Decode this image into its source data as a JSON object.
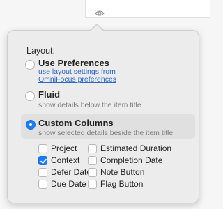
{
  "toolbar": {
    "view_options_icon": "eye-icon"
  },
  "popover": {
    "heading": "Layout:",
    "options": [
      {
        "title": "Use Preferences",
        "link": "use layout settings from OmniFocus preferences",
        "selected": false
      },
      {
        "title": "Fluid",
        "description": "show details below the item title",
        "selected": false
      },
      {
        "title": "Custom Columns",
        "description": "show selected details beside the item title",
        "selected": true
      }
    ],
    "columns": [
      {
        "label": "Project",
        "checked": false
      },
      {
        "label": "Estimated Duration",
        "checked": false
      },
      {
        "label": "Context",
        "checked": true
      },
      {
        "label": "Completion Date",
        "checked": false
      },
      {
        "label": "Defer Date",
        "checked": false
      },
      {
        "label": "Note Button",
        "checked": false
      },
      {
        "label": "Due Date",
        "checked": false
      },
      {
        "label": "Flag Button",
        "checked": false
      }
    ]
  },
  "colors": {
    "accent": "#1e7bf0",
    "link": "#2d68c4"
  }
}
